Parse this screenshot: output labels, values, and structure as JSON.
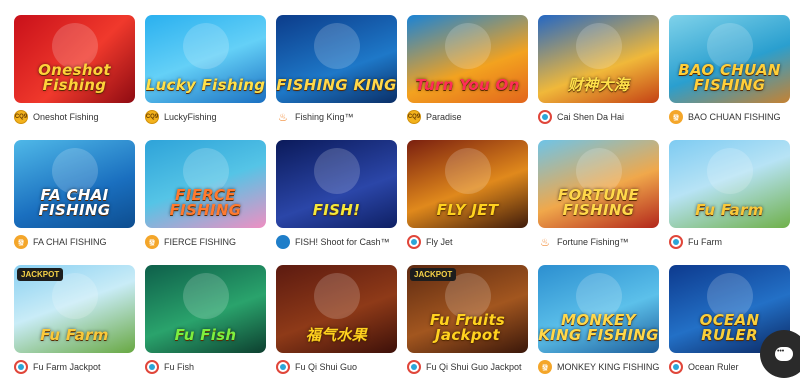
{
  "games": [
    {
      "name": "Oneshot Fishing",
      "provider": "CQ9",
      "art_title": "Oneshot Fishing",
      "jackpot": false,
      "logo": "cq9",
      "bg": "linear-gradient(135deg,#c8101a,#f0392c 55%,#8e0b12)",
      "art_color": "#ffd23a"
    },
    {
      "name": "LuckyFishing",
      "provider": "CQ9",
      "art_title": "Lucky Fishing",
      "jackpot": false,
      "logo": "cq9",
      "bg": "linear-gradient(160deg,#2ab0ef,#64d0f7 50%,#1a6fc1)",
      "art_color": "#ffe14a"
    },
    {
      "name": "Fishing King™",
      "provider": "",
      "art_title": "FISHING KING",
      "jackpot": false,
      "logo": "flame",
      "bg": "linear-gradient(160deg,#0c3c8a,#1e78c8 60%,#0a2e66)",
      "art_color": "#ffd84a"
    },
    {
      "name": "Paradise",
      "provider": "CQ9",
      "art_title": "Turn You On",
      "jackpot": false,
      "logo": "cq9",
      "bg": "linear-gradient(160deg,#1a83d6,#f3a21f 60%,#e2651c)",
      "art_color": "#ff2d57"
    },
    {
      "name": "Cai Shen Da Hai",
      "provider": "",
      "art_title": "财神大海",
      "jackpot": false,
      "logo": "spade",
      "bg": "linear-gradient(160deg,#2467c4,#f0b83a 60%,#c44114)",
      "art_color": "#ffe14a"
    },
    {
      "name": "BAO CHUAN FISHING",
      "provider": "JDB",
      "art_title": "BAO CHUAN FISHING",
      "jackpot": false,
      "logo": "jdb",
      "bg": "linear-gradient(160deg,#7fd2ea,#2a9fcf 55%,#c68232)",
      "art_color": "#ffcf3a"
    },
    {
      "name": "FA CHAI FISHING",
      "provider": "JDB",
      "art_title": "FA CHAI FISHING",
      "jackpot": false,
      "logo": "jdb",
      "bg": "linear-gradient(160deg,#4fb8e8,#1a6fbf 60%,#0d4d8f)",
      "art_color": "#ffffff"
    },
    {
      "name": "FIERCE FISHING",
      "provider": "JDB",
      "art_title": "FIERCE FISHING",
      "jackpot": false,
      "logo": "jdb",
      "bg": "linear-gradient(160deg,#2ea3d9,#55c4e6 50%,#ef8fc2)",
      "art_color": "#ff7a2f"
    },
    {
      "name": "FISH! Shoot for Cash™",
      "provider": "",
      "art_title": "FISH!",
      "jackpot": false,
      "logo": "rtg",
      "bg": "linear-gradient(160deg,#0b1a5a,#2b46a8 60%,#0e1f63)",
      "art_color": "#f4e83b"
    },
    {
      "name": "Fly Jet",
      "provider": "",
      "art_title": "FLY JET",
      "jackpot": false,
      "logo": "spade",
      "bg": "linear-gradient(160deg,#7a1f0f,#e0891c 55%,#3f1b0b)",
      "art_color": "#ffd21f"
    },
    {
      "name": "Fortune Fishing™",
      "provider": "",
      "art_title": "FORTUNE FISHING",
      "jackpot": false,
      "logo": "flame",
      "bg": "linear-gradient(160deg,#6ec4e8,#f0a84b 55%,#b2261b)",
      "art_color": "#ffd84a"
    },
    {
      "name": "Fu Farm",
      "provider": "",
      "art_title": "Fu Farm",
      "jackpot": false,
      "logo": "spade",
      "bg": "linear-gradient(160deg,#7ecbf2,#b7e3f5 45%,#6fb04a)",
      "art_color": "#f9c93b"
    },
    {
      "name": "Fu Farm Jackpot",
      "provider": "",
      "art_title": "Fu Farm",
      "jackpot": true,
      "logo": "spade",
      "bg": "linear-gradient(160deg,#8ad0f2,#c9ecf7 45%,#68a842)",
      "art_color": "#f9c93b"
    },
    {
      "name": "Fu Fish",
      "provider": "",
      "art_title": "Fu Fish",
      "jackpot": false,
      "logo": "spade",
      "bg": "linear-gradient(160deg,#0e5f4a,#2aa36c 55%,#0d3f2f)",
      "art_color": "#7cf03f"
    },
    {
      "name": "Fu Qi Shui Guo",
      "provider": "",
      "art_title": "福气水果",
      "jackpot": false,
      "logo": "spade",
      "bg": "linear-gradient(160deg,#5c1a10,#8e3a18 55%,#3d1009)",
      "art_color": "#ffd21f"
    },
    {
      "name": "Fu Qi Shui Guo Jackpot",
      "provider": "",
      "art_title": "Fu Fruits Jackpot",
      "jackpot": true,
      "logo": "spade",
      "bg": "linear-gradient(160deg,#5e2a12,#a2561f 55%,#3a170a)",
      "art_color": "#ffd21f"
    },
    {
      "name": "MONKEY KING FISHING",
      "provider": "JDB",
      "art_title": "MONKEY KING FISHING",
      "jackpot": false,
      "logo": "jdb",
      "bg": "linear-gradient(160deg,#2c8fd0,#5cc0ea 55%,#1b5a98)",
      "art_color": "#ffd84a"
    },
    {
      "name": "Ocean Ruler",
      "provider": "",
      "art_title": "OCEAN RULER",
      "jackpot": false,
      "logo": "spade",
      "bg": "linear-gradient(160deg,#0d3a8e,#2370c6 55%,#0a2660)",
      "art_color": "#f7cf3c"
    }
  ],
  "jackpot_label": "JACKPOT",
  "chat_button": {
    "icon": "chat-bubble-icon"
  }
}
